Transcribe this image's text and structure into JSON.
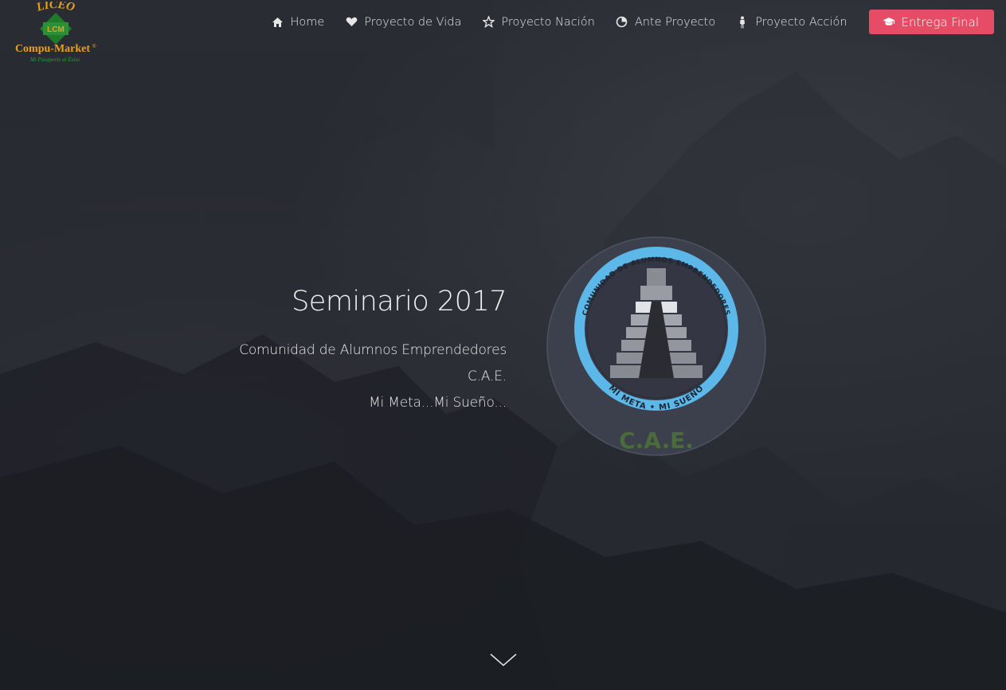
{
  "logo": {
    "top_word": "LICEO",
    "badge": "LCM",
    "brand": "Compu-Market",
    "registered": "®",
    "slogan": "Mi Pasaporte al Éxito"
  },
  "nav": {
    "items": [
      {
        "label": "Home",
        "icon": "home-icon"
      },
      {
        "label": "Proyecto de Vida",
        "icon": "heart-icon"
      },
      {
        "label": "Proyecto Nación",
        "icon": "star-icon"
      },
      {
        "label": "Ante Proyecto",
        "icon": "pie-chart-icon"
      },
      {
        "label": "Proyecto Acción",
        "icon": "person-icon"
      }
    ],
    "cta": {
      "label": "Entrega Final",
      "icon": "graduation-cap-icon",
      "color": "#e64c65"
    }
  },
  "hero": {
    "title": "Seminario 2017",
    "line1": "Comunidad de Alumnos Emprendedores",
    "line2": "C.A.E.",
    "line3": "Mi Meta...Mi Sueño..."
  },
  "emblem": {
    "ring_top": "COMUNIDAD DE ALUMNOS EMPRENDEDORES",
    "ring_bottom": "MI META • MI SUEÑO",
    "caption": "C.A.E.",
    "ring_color": "#5bb8e8",
    "caption_color": "#4a6b3a"
  },
  "scroll": {
    "icon": "chevron-down-icon"
  }
}
